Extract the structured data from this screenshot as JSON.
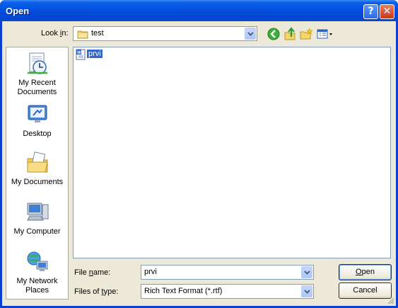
{
  "window": {
    "title": "Open",
    "help_label": "?",
    "close_label": "✕"
  },
  "lookin": {
    "label_pre": "Look ",
    "label_mnemonic": "i",
    "label_post": "n:",
    "value": "test",
    "toolbar_icons": [
      "back-icon",
      "up-folder-icon",
      "new-folder-icon",
      "views-menu-icon"
    ]
  },
  "places": [
    {
      "name": "recent",
      "label": "My Recent Documents"
    },
    {
      "name": "desktop",
      "label": "Desktop"
    },
    {
      "name": "mydocs",
      "label": "My Documents"
    },
    {
      "name": "mycomputer",
      "label": "My Computer"
    },
    {
      "name": "network",
      "label": "My Network Places"
    }
  ],
  "files": [
    {
      "name": "prvi",
      "icon": "rtf-document-icon",
      "selected": true
    }
  ],
  "filename": {
    "label_pre": "File ",
    "label_mnemonic": "n",
    "label_post": "ame:",
    "value": "prvi"
  },
  "filetype": {
    "label_pre": "Files of ",
    "label_mnemonic": "t",
    "label_post": "ype:",
    "value": "Rich Text Format (*.rtf)"
  },
  "buttons": {
    "open_mnemonic": "O",
    "open_rest": "pen",
    "cancel": "Cancel"
  },
  "colors": {
    "titlebar": "#0551e0",
    "client": "#ece9d8",
    "selection": "#316ac5"
  }
}
